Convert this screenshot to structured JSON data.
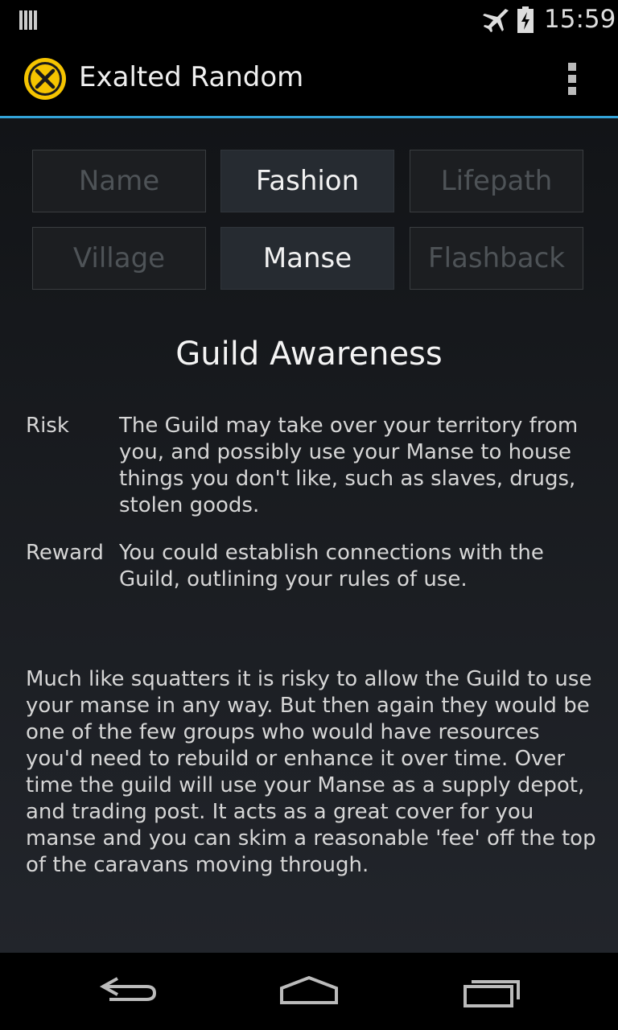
{
  "status_bar": {
    "time": "15:59",
    "icons": [
      "notification-icon",
      "airplane-icon",
      "battery-charging-icon"
    ]
  },
  "action_bar": {
    "title": "Exalted Random",
    "app_icon": "exalted-logo-icon",
    "menu_icon": "overflow-menu-icon"
  },
  "tabs": [
    {
      "label": "Name",
      "active": false
    },
    {
      "label": "Fashion",
      "active": true
    },
    {
      "label": "Lifepath",
      "active": false
    },
    {
      "label": "Village",
      "active": false
    },
    {
      "label": "Manse",
      "active": true
    },
    {
      "label": "Flashback",
      "active": false
    }
  ],
  "result": {
    "title": "Guild Awareness",
    "risk_label": "Risk",
    "risk_text": "The Guild may take over your territory from you, and possibly use your Manse to house things you don't like, such as slaves, drugs, stolen goods.",
    "reward_label": "Reward",
    "reward_text": "You could establish connections with the Guild, outlining your rules of use.",
    "description": "Much like squatters it is risky to allow the Guild to use your manse in any way. But then again they would be one of the few groups who would have resources you'd need to rebuild or enhance it over time. Over time the guild will use your Manse as a supply depot, and trading post. It acts as a great cover for you manse and you can skim a reasonable 'fee' off the top of the caravans moving through."
  },
  "nav_bar": {
    "buttons": [
      "back-icon",
      "home-icon",
      "recent-apps-icon"
    ]
  },
  "colors": {
    "accent": "#33a3d8",
    "logo": "#f5c400",
    "tab_active_text": "#f2f2f2",
    "tab_inactive_text": "#4e5357"
  }
}
